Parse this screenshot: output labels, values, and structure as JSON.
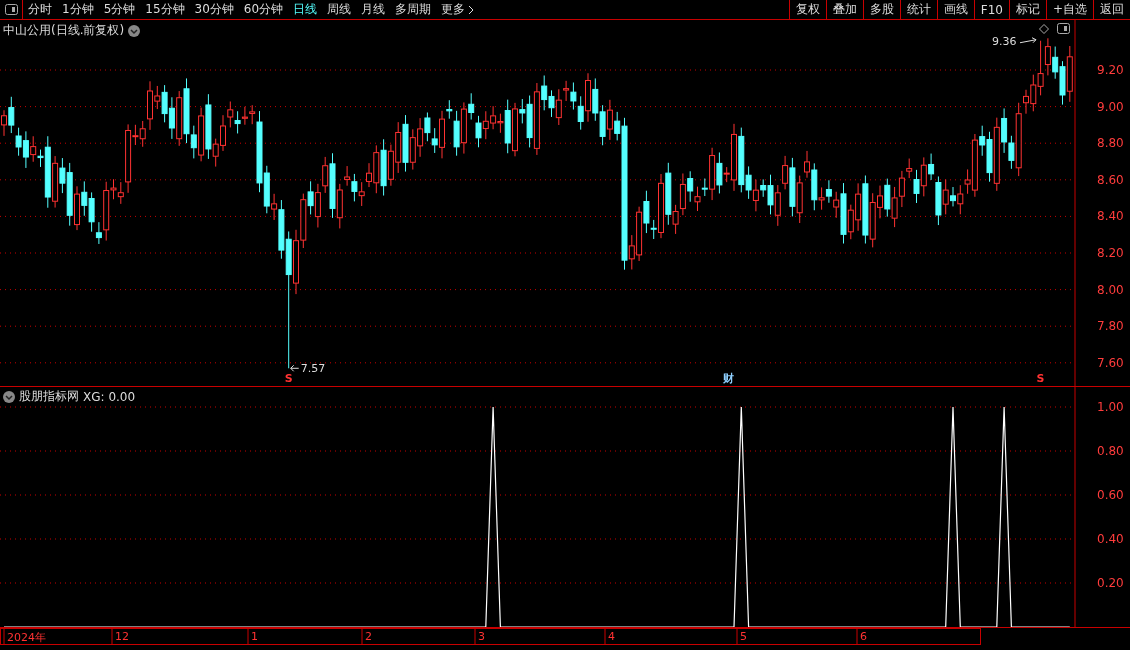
{
  "toolbar": {
    "periods": [
      {
        "label": "分时",
        "selected": false
      },
      {
        "label": "1分钟",
        "selected": false
      },
      {
        "label": "5分钟",
        "selected": false
      },
      {
        "label": "15分钟",
        "selected": false
      },
      {
        "label": "30分钟",
        "selected": false
      },
      {
        "label": "60分钟",
        "selected": false
      },
      {
        "label": "日线",
        "selected": true
      },
      {
        "label": "周线",
        "selected": false
      },
      {
        "label": "月线",
        "selected": false
      },
      {
        "label": "多周期",
        "selected": false
      },
      {
        "label": "更多",
        "selected": false
      }
    ],
    "buttons": [
      "复权",
      "叠加",
      "多股",
      "统计",
      "画线",
      "F10",
      "标记",
      "+自选",
      "返回"
    ]
  },
  "main_chart": {
    "title": "中山公用(日线.前复权)",
    "yticks": [
      "9.20",
      "9.00",
      "8.80",
      "8.60",
      "8.40",
      "8.20",
      "8.00",
      "7.80",
      "7.60"
    ],
    "low_label": "7.57",
    "high_label": "9.36",
    "markers": [
      {
        "text": "S",
        "kind": "signal"
      },
      {
        "text": "财",
        "kind": "finance"
      },
      {
        "text": "S",
        "kind": "signal"
      }
    ]
  },
  "indicator": {
    "title": "股朋指标网",
    "reading": ": 0.00",
    "chart_data": {
      "type": "line",
      "grid": true,
      "ylim": [
        0,
        1
      ],
      "yticks": [
        {
          "value": 0.2,
          "label": "0.20"
        },
        {
          "value": 0.4,
          "label": "0.40"
        },
        {
          "value": 0.6,
          "label": "0.60"
        },
        {
          "value": 0.8,
          "label": "0.80"
        },
        {
          "value": 1,
          "label": "1.00"
        }
      ],
      "series": [
        {
          "name": "XG",
          "color": "#ffffff",
          "values": [
            0,
            0,
            0,
            0,
            0,
            0,
            0,
            0,
            0,
            0,
            0,
            0,
            0,
            0,
            0,
            0,
            0,
            0,
            0,
            0,
            0,
            0,
            0,
            0,
            0,
            0,
            0,
            0,
            0,
            0,
            0,
            0,
            0,
            0,
            0,
            0,
            0,
            0,
            0,
            0,
            0,
            0,
            0,
            0,
            0,
            0,
            0,
            0,
            0,
            0,
            0,
            0,
            0,
            0,
            0,
            0,
            0,
            0,
            0,
            0,
            0,
            0,
            0,
            0,
            0,
            0,
            0,
            1,
            0,
            0,
            0,
            0,
            0,
            0,
            0,
            0,
            0,
            0,
            0,
            0,
            0,
            0,
            0,
            0,
            0,
            0,
            0,
            0,
            0,
            0,
            0,
            0,
            0,
            0,
            0,
            0,
            0,
            0,
            0,
            0,
            0,
            1,
            0,
            0,
            0,
            0,
            0,
            0,
            0,
            0,
            0,
            0,
            0,
            0,
            0,
            0,
            0,
            0,
            0,
            0,
            0,
            0,
            0,
            0,
            0,
            0,
            0,
            0,
            0,
            0,
            1,
            0,
            0,
            0,
            0,
            0,
            0,
            1,
            0,
            0,
            0,
            0,
            0,
            0,
            0,
            0,
            0
          ]
        }
      ]
    }
  },
  "time_axis": [
    "2024年",
    "12",
    "1",
    "2",
    "3",
    "4",
    "5",
    "6"
  ]
}
